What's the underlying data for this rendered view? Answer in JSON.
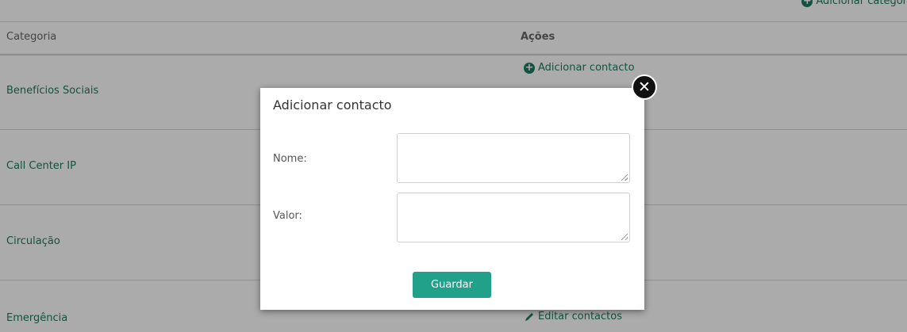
{
  "top_action": {
    "label": "Adicionar categor"
  },
  "table": {
    "headers": {
      "category": "Categoria",
      "actions": "Ações"
    },
    "rows": [
      {
        "category": "Benefícios Sociais",
        "action": "Adicionar contacto"
      },
      {
        "category": "Call Center IP"
      },
      {
        "category": "Circulação"
      },
      {
        "category": "Emergência",
        "action": "Editar contactos"
      }
    ]
  },
  "modal": {
    "title": "Adicionar contacto",
    "fields": [
      {
        "label": "Nome:",
        "value": ""
      },
      {
        "label": "Valor:",
        "value": ""
      }
    ],
    "save_label": "Guardar",
    "close_icon_glyph": "✕"
  },
  "colors": {
    "accent": "#21a08a",
    "link": "#1d7b60"
  }
}
